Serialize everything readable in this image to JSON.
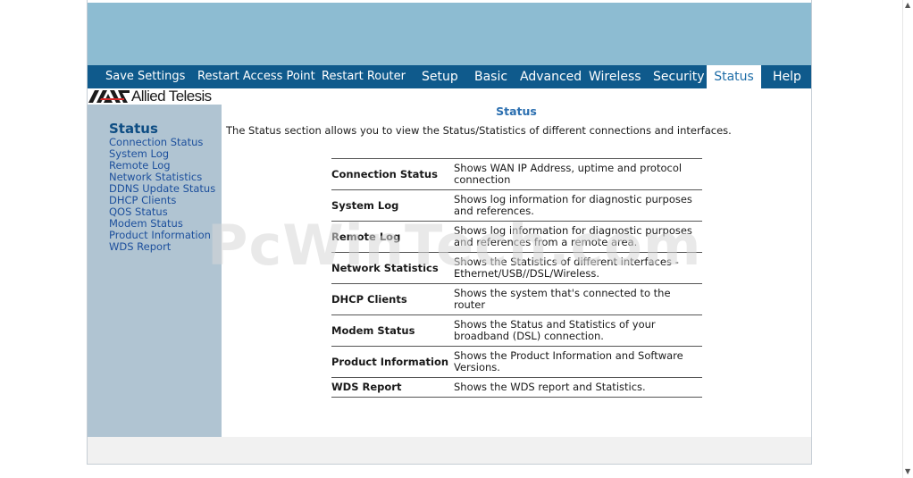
{
  "nav": {
    "items": [
      {
        "label": "Save Settings",
        "active": false
      },
      {
        "label": "Restart Access Point",
        "active": false
      },
      {
        "label": "Restart Router",
        "active": false
      },
      {
        "label": "Setup",
        "active": false
      },
      {
        "label": "Basic",
        "active": false
      },
      {
        "label": "Advanced",
        "active": false
      },
      {
        "label": "Wireless",
        "active": false
      },
      {
        "label": "Security",
        "active": false
      },
      {
        "label": "Status",
        "active": true
      },
      {
        "label": "Help",
        "active": false
      }
    ]
  },
  "brand": {
    "logo_text": "Allied Telesis"
  },
  "sidebar": {
    "title": "Status",
    "items": [
      "Connection Status",
      "System Log",
      "Remote Log",
      "Network Statistics",
      "DDNS Update Status",
      "DHCP Clients",
      "QOS Status",
      "Modem Status",
      "Product Information",
      "WDS Report"
    ]
  },
  "main": {
    "title": "Status",
    "intro": "The Status section allows you to view the Status/Statistics of different connections and interfaces.",
    "rows": [
      {
        "name": "Connection Status",
        "desc": "Shows WAN IP Address, uptime and protocol connection"
      },
      {
        "name": "System Log",
        "desc": "Shows log information for diagnostic purposes and references."
      },
      {
        "name": "Remote Log",
        "desc": "Shows log information for diagnostic purposes and references from a remote area."
      },
      {
        "name": "Network Statistics",
        "desc": "Shows the Statistics of different interfaces - Ethernet/USB//DSL/Wireless."
      },
      {
        "name": "DHCP Clients",
        "desc": "Shows the system that's connected to the router"
      },
      {
        "name": "Modem Status",
        "desc": "Shows the Status and Statistics of your broadband (DSL) connection."
      },
      {
        "name": "Product Information",
        "desc": "Shows the Product Information and Software Versions."
      },
      {
        "name": "WDS Report",
        "desc": "Shows the WDS report and Statistics."
      }
    ]
  },
  "watermark": "PcWinTech.com",
  "colors": {
    "banner": "#8dbcd2",
    "navbar": "#0f5a8c",
    "sidebar": "#b0c4d2",
    "accent": "#2b6fb0"
  }
}
